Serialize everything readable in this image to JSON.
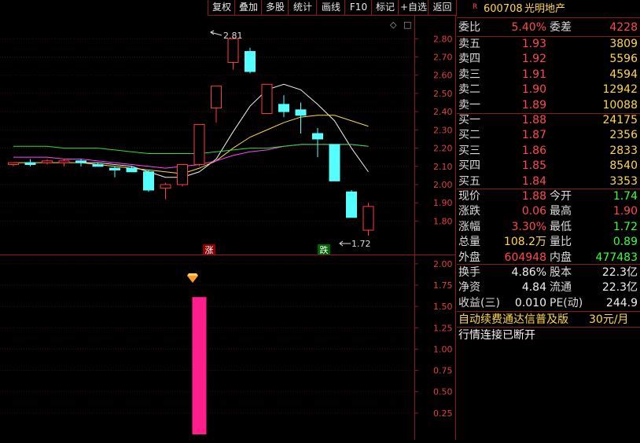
{
  "toolbar": {
    "buttons": [
      "复权",
      "叠加",
      "多股",
      "统计",
      "画线",
      "F10",
      "标记",
      "+自选",
      "返回"
    ]
  },
  "price_chart": {
    "y_ticks": [
      "2.80",
      "2.70",
      "2.60",
      "2.50",
      "2.40",
      "2.30",
      "2.20",
      "2.10",
      "2.00",
      "1.90",
      "1.80"
    ],
    "high_label": "2.81",
    "low_label": "1.72",
    "limit_up_tag": "涨",
    "limit_down_tag": "跌",
    "expand_symbol": "◇",
    "settings_symbol": "□"
  },
  "indicator_chart": {
    "y_ticks": [
      "2.00",
      "1.75",
      "1.50",
      "1.25",
      "1.00",
      "0.75",
      "0.50",
      "0.25"
    ]
  },
  "chart_data": [
    {
      "type": "candlestick",
      "ylim": [
        1.72,
        2.84
      ],
      "candles": [
        {
          "o": 2.11,
          "h": 2.12,
          "l": 2.1,
          "c": 2.12
        },
        {
          "o": 2.12,
          "h": 2.14,
          "l": 2.1,
          "c": 2.11
        },
        {
          "o": 2.12,
          "h": 2.14,
          "l": 2.11,
          "c": 2.13
        },
        {
          "o": 2.12,
          "h": 2.14,
          "l": 2.1,
          "c": 2.13
        },
        {
          "o": 2.13,
          "h": 2.14,
          "l": 2.1,
          "c": 2.12
        },
        {
          "o": 2.11,
          "h": 2.12,
          "l": 2.1,
          "c": 2.1
        },
        {
          "o": 2.09,
          "h": 2.1,
          "l": 2.04,
          "c": 2.08
        },
        {
          "o": 2.09,
          "h": 2.1,
          "l": 2.07,
          "c": 2.07
        },
        {
          "o": 2.07,
          "h": 2.08,
          "l": 1.96,
          "c": 1.97
        },
        {
          "o": 1.98,
          "h": 2.01,
          "l": 1.92,
          "c": 2.0
        },
        {
          "o": 2.0,
          "h": 2.11,
          "l": 1.99,
          "c": 2.11
        },
        {
          "o": 2.11,
          "h": 2.33,
          "l": 2.1,
          "c": 2.33
        },
        {
          "o": 2.42,
          "h": 2.54,
          "l": 2.34,
          "c": 2.54
        },
        {
          "o": 2.67,
          "h": 2.81,
          "l": 2.63,
          "c": 2.8
        },
        {
          "o": 2.73,
          "h": 2.75,
          "l": 2.61,
          "c": 2.62
        },
        {
          "o": 2.39,
          "h": 2.55,
          "l": 2.39,
          "c": 2.55
        },
        {
          "o": 2.44,
          "h": 2.49,
          "l": 2.37,
          "c": 2.4
        },
        {
          "o": 2.41,
          "h": 2.45,
          "l": 2.28,
          "c": 2.38
        },
        {
          "o": 2.28,
          "h": 2.31,
          "l": 2.15,
          "c": 2.25
        },
        {
          "o": 2.22,
          "h": 2.22,
          "l": 2.02,
          "c": 2.02
        },
        {
          "o": 1.96,
          "h": 1.97,
          "l": 1.82,
          "c": 1.82
        },
        {
          "o": 1.75,
          "h": 1.9,
          "l": 1.72,
          "c": 1.88
        }
      ],
      "ma_lines": [
        {
          "color": "#f0f0f0",
          "values": [
            null,
            null,
            null,
            null,
            2.12,
            2.12,
            2.11,
            2.1,
            2.07,
            2.04,
            2.04,
            2.07,
            2.14,
            2.29,
            2.43,
            2.52,
            2.55,
            2.52,
            2.44,
            2.35,
            2.2,
            2.07
          ]
        },
        {
          "color": "#ffd84a",
          "values": [
            2.12,
            2.12,
            2.12,
            2.12,
            2.12,
            2.11,
            2.1,
            2.09,
            2.08,
            2.07,
            2.06,
            2.09,
            2.13,
            2.2,
            2.26,
            2.3,
            2.34,
            2.37,
            2.38,
            2.38,
            2.35,
            2.32
          ]
        },
        {
          "color": "#ff44ff",
          "values": [
            2.15,
            2.15,
            2.15,
            2.14,
            2.14,
            2.13,
            2.12,
            2.11,
            2.1,
            2.09,
            2.1,
            2.11,
            2.13,
            2.16,
            2.18,
            2.19,
            2.21,
            2.22,
            2.22,
            2.22,
            2.22,
            2.21
          ]
        },
        {
          "color": "#33dd33",
          "values": [
            2.21,
            2.21,
            2.21,
            2.2,
            2.2,
            2.2,
            2.19,
            2.18,
            2.17,
            2.17,
            2.17,
            2.17,
            2.18,
            2.19,
            2.2,
            2.2,
            2.21,
            2.22,
            2.22,
            2.22,
            2.22,
            2.21
          ]
        }
      ]
    },
    {
      "type": "bar",
      "ylim": [
        0,
        2.1
      ],
      "values": [
        0,
        0,
        0,
        0,
        0,
        0,
        0,
        0,
        0,
        0,
        0,
        1.61,
        0,
        0,
        0,
        0,
        0,
        0,
        0,
        0,
        0,
        0
      ],
      "bar_color": "#ff1e8c"
    }
  ],
  "quote": {
    "badge": "R",
    "code": "600708",
    "name": "光明地产",
    "weibi_label": "委比",
    "weibi_value": "5.40%",
    "weicha_label": "委差",
    "weicha_value": "4228",
    "asks": [
      {
        "label": "卖五",
        "price": "1.93",
        "vol": "3809"
      },
      {
        "label": "卖四",
        "price": "1.92",
        "vol": "5596"
      },
      {
        "label": "卖三",
        "price": "1.91",
        "vol": "4594"
      },
      {
        "label": "卖二",
        "price": "1.90",
        "vol": "12942"
      },
      {
        "label": "卖一",
        "price": "1.89",
        "vol": "10088"
      }
    ],
    "bids": [
      {
        "label": "买一",
        "price": "1.88",
        "vol": "24175"
      },
      {
        "label": "买二",
        "price": "1.87",
        "vol": "2356"
      },
      {
        "label": "买三",
        "price": "1.86",
        "vol": "2833"
      },
      {
        "label": "买四",
        "price": "1.85",
        "vol": "8540"
      },
      {
        "label": "买五",
        "price": "1.84",
        "vol": "3353"
      }
    ],
    "stats": [
      {
        "l1": "现价",
        "v1": "1.88",
        "c1": "red",
        "l2": "今开",
        "v2": "1.74",
        "c2": "green"
      },
      {
        "l1": "涨跌",
        "v1": "0.06",
        "c1": "red",
        "l2": "最高",
        "v2": "1.90",
        "c2": "red"
      },
      {
        "l1": "涨幅",
        "v1": "3.30%",
        "c1": "red",
        "l2": "最低",
        "v2": "1.72",
        "c2": "green"
      },
      {
        "l1": "总量",
        "v1": "108.2万",
        "c1": "yellow",
        "l2": "量比",
        "v2": "0.89",
        "c2": "green"
      },
      {
        "l1": "外盘",
        "v1": "604948",
        "c1": "red",
        "l2": "内盘",
        "v2": "477483",
        "c2": "green"
      }
    ],
    "fundamentals": [
      {
        "l1": "换手",
        "v1": "4.86%",
        "l2": "股本",
        "v2": "22.3亿"
      },
      {
        "l1": "净资",
        "v1": "4.84",
        "l2": "流通",
        "v2": "22.3亿"
      },
      {
        "l1": "收益(三)",
        "v1": "0.010",
        "l2": "PE(动)",
        "v2": "244.9"
      }
    ],
    "promo_text": "自动续费通达信普及版",
    "promo_price": "30元/月",
    "connection_status": "行情连接已断开"
  }
}
